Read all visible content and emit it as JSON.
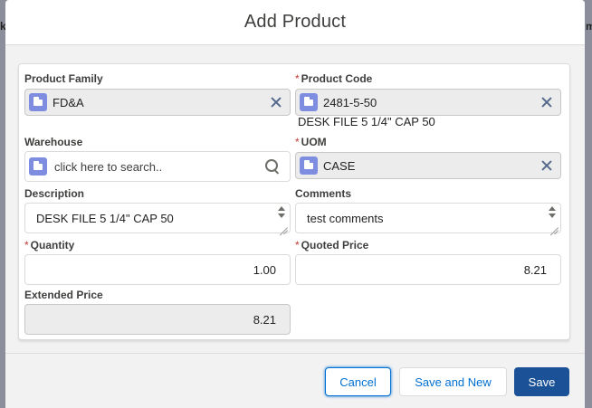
{
  "modal": {
    "title": "Add Product"
  },
  "background": {
    "frag1": "k",
    "frag2": "m"
  },
  "fields": {
    "product_family": {
      "label": "Product Family",
      "value": "FD&A"
    },
    "product_code": {
      "label": "Product Code",
      "value": "2481-5-50",
      "subtext": "DESK FILE 5 1/4\" CAP 50"
    },
    "warehouse": {
      "label": "Warehouse",
      "placeholder": "click here to search.."
    },
    "uom": {
      "label": "UOM",
      "value": "CASE"
    },
    "description": {
      "label": "Description",
      "value": "DESK FILE 5 1/4\" CAP 50"
    },
    "comments": {
      "label": "Comments",
      "value": "test comments"
    },
    "quantity": {
      "label": "Quantity",
      "value": "1.00"
    },
    "quoted_price": {
      "label": "Quoted Price",
      "value": "8.21"
    },
    "extended_price": {
      "label": "Extended Price",
      "value": "8.21"
    }
  },
  "required_marker": "*",
  "footer": {
    "cancel_label": "Cancel",
    "save_new_label": "Save and New",
    "save_label": "Save"
  },
  "colors": {
    "brand": "#1b5297",
    "link": "#0070d2",
    "required": "#c23934",
    "object_icon": "#7f8de1"
  },
  "icons": {
    "lookup": "product-object-icon",
    "clear": "close-icon",
    "search": "search-icon"
  }
}
